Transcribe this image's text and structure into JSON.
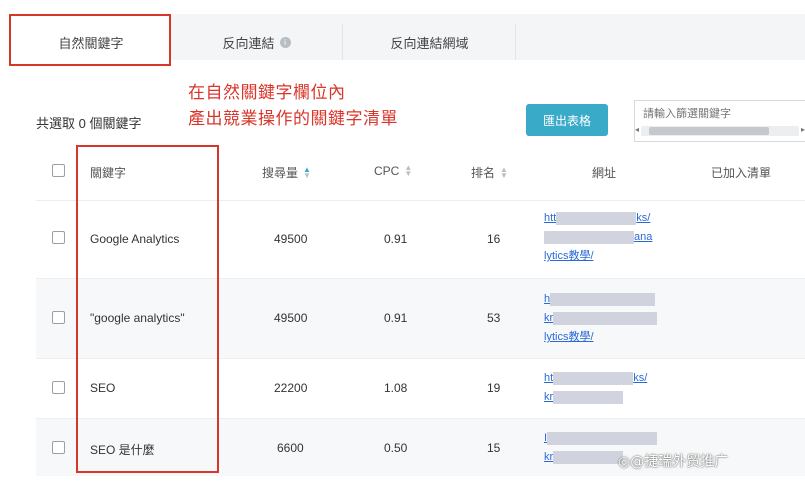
{
  "tabs": [
    {
      "label": "自然關鍵字",
      "active": true
    },
    {
      "label": "反向連結",
      "active": false,
      "info_icon": "info-icon"
    },
    {
      "label": "反向連結網域",
      "active": false
    }
  ],
  "annotation": {
    "line1": "在自然關鍵字欄位內",
    "line2": "產出競業操作的關鍵字清單"
  },
  "toolbar": {
    "selected_count": "共選取 0 個關鍵字",
    "export_label": "匯出表格",
    "filter_placeholder": "請輸入篩選關鍵字"
  },
  "table": {
    "headers": {
      "keyword": "關鍵字",
      "volume": "搜尋量",
      "cpc": "CPC",
      "rank": "排名",
      "url": "網址",
      "added": "已加入清單"
    },
    "rows": [
      {
        "keyword": "Google Analytics",
        "volume": "49500",
        "cpc": "0.91",
        "rank": "16",
        "url_lines": [
          "htt",
          "ks/",
          "ana",
          "lytics教學/"
        ]
      },
      {
        "keyword": "\"google analytics\"",
        "volume": "49500",
        "cpc": "0.91",
        "rank": "53",
        "url_lines": [
          "h",
          "kr",
          "lytics教學/"
        ]
      },
      {
        "keyword": "SEO",
        "volume": "22200",
        "cpc": "1.08",
        "rank": "19",
        "url_lines": [
          "ht",
          "ks/",
          "kr"
        ]
      },
      {
        "keyword": "SEO 是什麼",
        "volume": "6600",
        "cpc": "0.50",
        "rank": "15",
        "url_lines": [
          "I",
          "kr"
        ]
      }
    ]
  },
  "watermark": "◎@捷瑞外贸推广",
  "colors": {
    "accent": "#3aaac9",
    "highlight": "#d9362b",
    "link": "#2a6ad8"
  }
}
